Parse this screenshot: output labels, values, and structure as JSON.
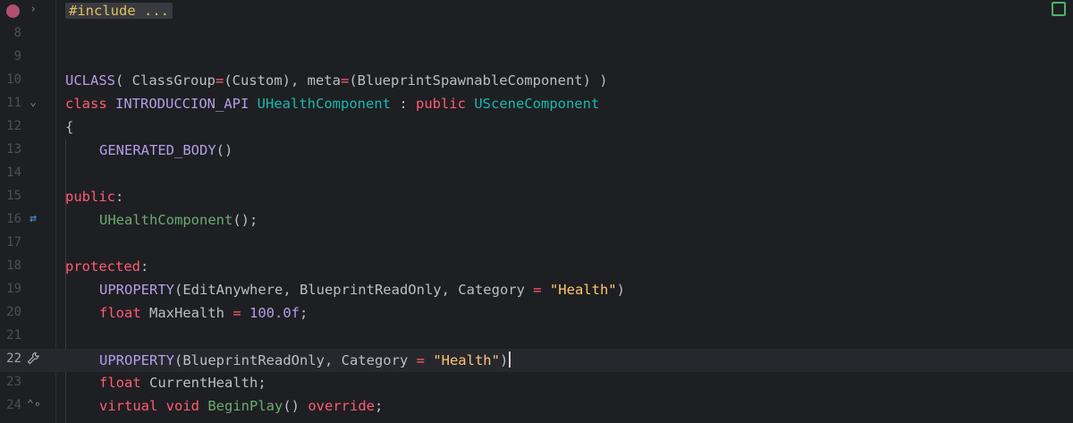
{
  "editor": {
    "folded_include": "#include ...",
    "lines": {
      "l8": "8",
      "l9": "9",
      "l10": "10",
      "l11": "11",
      "l12": "12",
      "l13": "13",
      "l14": "14",
      "l15": "15",
      "l16": "16",
      "l17": "17",
      "l18": "18",
      "l19": "19",
      "l20": "20",
      "l21": "21",
      "l22": "22",
      "l23": "23",
      "l24": "24"
    },
    "tokens": {
      "uclass": "UCLASS",
      "uclass_args_open": "( ClassGroup",
      "uclass_eq1": "=",
      "uclass_custom": "(Custom), meta",
      "uclass_eq2": "=",
      "uclass_args_rest": "(BlueprintSpawnableComponent) )",
      "class_kw": "class",
      "api": "INTRODUCCION_API",
      "class_name": "UHealthComponent",
      "colon": " : ",
      "public_kw": "public",
      "base_class": "USceneComponent",
      "brace_open": "{",
      "generated_body": "GENERATED_BODY",
      "generated_parens": "()",
      "public_label": "public",
      "colon_label": ":",
      "ctor": "UHealthComponent",
      "ctor_tail": "();",
      "protected_label": "protected",
      "colon_label2": ":",
      "uprop1": "UPROPERTY",
      "uprop1_args": "(EditAnywhere, BlueprintReadOnly, Category ",
      "uprop1_eq": "=",
      "uprop1_str": "\"Health\"",
      "uprop1_close": ")",
      "float_kw": "float",
      "maxhealth": " MaxHealth ",
      "eq": "=",
      "num": "100.0f",
      "semi": ";",
      "uprop2": "UPROPERTY",
      "uprop2_args": "(BlueprintReadOnly, Category ",
      "uprop2_eq": "=",
      "uprop2_str": "\"Health\"",
      "uprop2_close": ")",
      "float_kw2": "float",
      "currenthealth": " CurrentHealth;",
      "virtual_kw": "virtual",
      "void_kw": "void",
      "beginplay": "BeginPlay",
      "beginplay_parens": "() ",
      "override_kw": "override",
      "semi2": ";"
    }
  }
}
